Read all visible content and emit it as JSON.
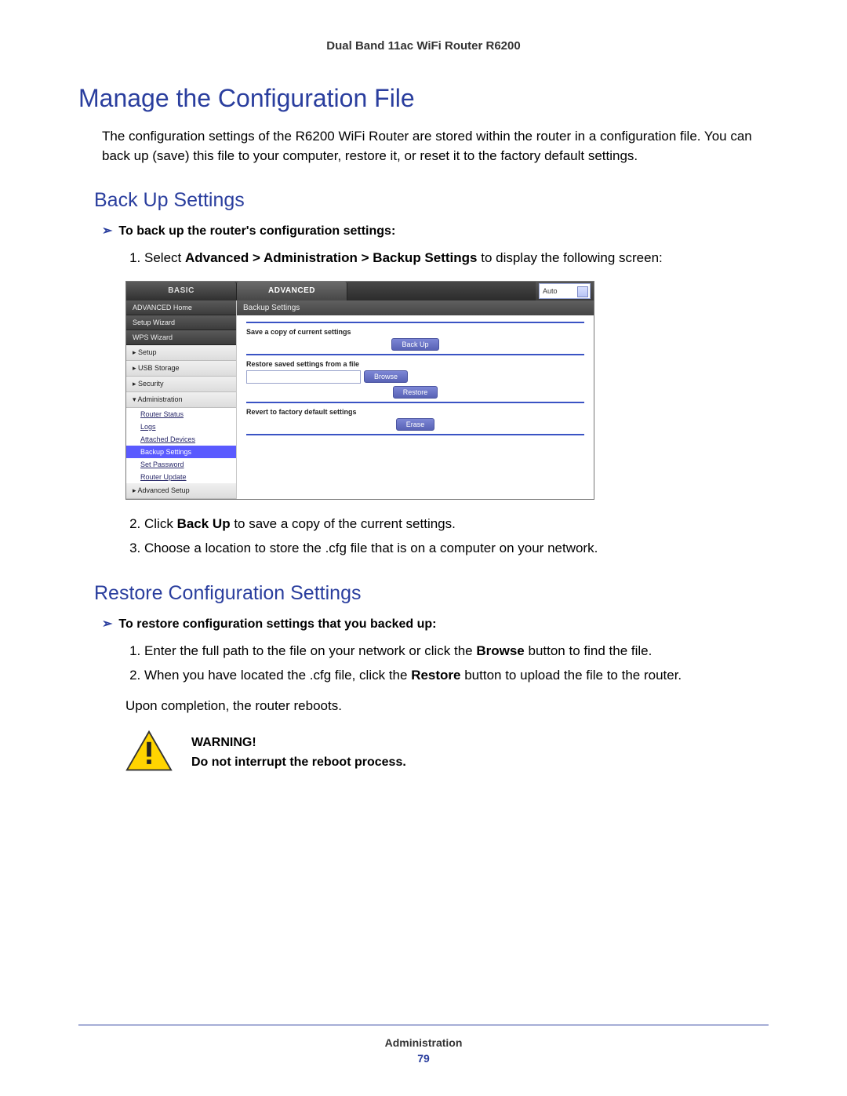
{
  "header": "Dual Band 11ac WiFi Router R6200",
  "h1": "Manage the Configuration File",
  "intro": "The configuration settings of the R6200 WiFi Router are stored within the router in a configuration file. You can back up (save) this file to your computer, restore it, or reset it to the factory default settings.",
  "backup": {
    "heading": "Back Up Settings",
    "task": "To back up the router's configuration settings:",
    "step1_a": "Select ",
    "step1_b": "Advanced > Administration > Backup Settings",
    "step1_c": " to display the following screen:",
    "step2_a": "Click ",
    "step2_b": "Back Up",
    "step2_c": " to save a copy of the current settings.",
    "step3": "Choose a location to store the .cfg file that is on a computer on your network."
  },
  "restore": {
    "heading": "Restore Configuration Settings",
    "task": "To restore configuration settings that you backed up:",
    "step1_a": "Enter the full path to the file on your network or click the ",
    "step1_b": "Browse",
    "step1_c": " button to find the file.",
    "step2_a": "When you have located the .cfg file, click the ",
    "step2_b": "Restore",
    "step2_c": " button to upload the file to the router.",
    "completion": "Upon completion, the router reboots."
  },
  "warning": {
    "label": "WARNING!",
    "text": "Do not interrupt the reboot process."
  },
  "footer": {
    "section": "Administration",
    "page": "79"
  },
  "ui": {
    "tabs": {
      "basic": "BASIC",
      "advanced": "ADVANCED",
      "auto": "Auto"
    },
    "sidebar": {
      "advanced_home": "ADVANCED Home",
      "setup_wizard": "Setup Wizard",
      "wps_wizard": "WPS Wizard",
      "setup": "▸ Setup",
      "usb": "▸ USB Storage",
      "security": "▸ Security",
      "administration": "▾ Administration",
      "router_status": "Router Status",
      "logs": "Logs",
      "attached": "Attached Devices",
      "backup_settings": "Backup Settings",
      "set_password": "Set Password",
      "router_update": "Router Update",
      "advanced_setup": "▸ Advanced Setup"
    },
    "content": {
      "title": "Backup Settings",
      "save_label": "Save a copy of current settings",
      "backup_btn": "Back Up",
      "restore_label": "Restore saved settings from a file",
      "browse_btn": "Browse",
      "restore_btn": "Restore",
      "revert_label": "Revert to factory default settings",
      "erase_btn": "Erase"
    }
  }
}
